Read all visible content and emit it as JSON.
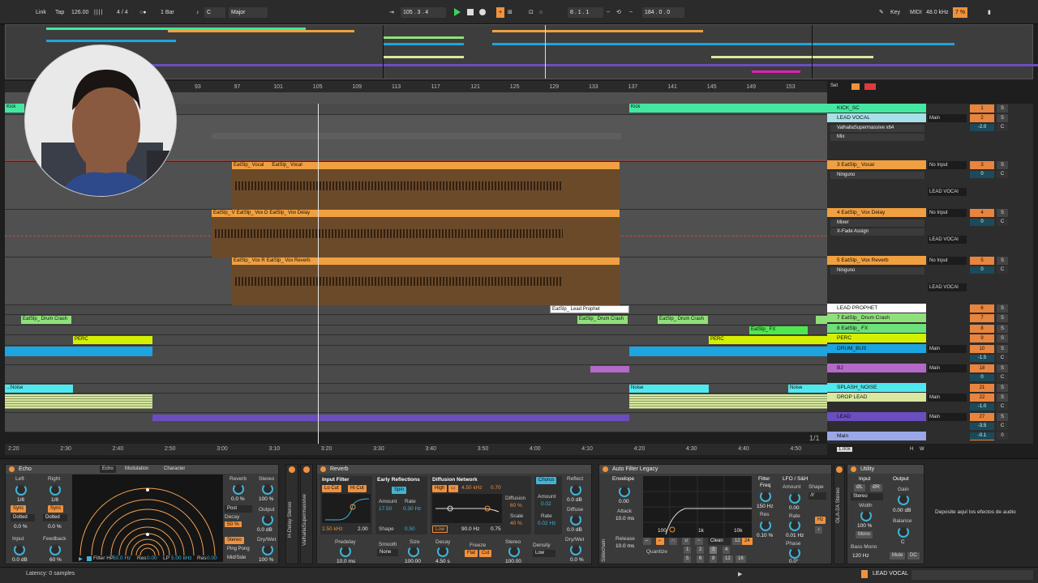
{
  "transport": {
    "link": "Link",
    "tap": "Tap",
    "tempo": "126.00",
    "signature": "4 / 4",
    "quant": "1 Bar",
    "key": "C",
    "scale": "Major",
    "position": "105 .  3 .  4",
    "loop_start": "8 .  1 .  1",
    "loop_len": "184 .  0 .  0",
    "key_btn": "Key",
    "midi": "MIDI",
    "sample_rate": "48.0 kHz",
    "cpu": "7 %"
  },
  "ruler": [
    "93",
    "97",
    "101",
    "105",
    "109",
    "113",
    "117",
    "121",
    "125",
    "129",
    "133",
    "137",
    "141",
    "145",
    "149",
    "153"
  ],
  "ruler_set": "Set",
  "time_ruler": [
    "2:20",
    "2:30",
    "2:40",
    "2:50",
    "3:00",
    "3:10",
    "3:20",
    "3:30",
    "3:40",
    "3:50",
    "4:00",
    "4:10",
    "4:20",
    "4:30",
    "4:40",
    "4:50"
  ],
  "page_indicator": "1/1",
  "zoom": "1.00x",
  "h_w": [
    "H",
    "W"
  ],
  "clips": {
    "kick_left": "Kick",
    "kick_right": "Kick",
    "vocal": "EatSlp_ Vocal",
    "vocal2": "EatSlp_ Vocal",
    "vox_delay_a": "EatSlp_ V",
    "vox_delay_b": "EatSlp_ Vox D",
    "vox_delay_c": "EatSlp_ Vox Delay",
    "vox_rev_a": "EatSlp_ Vox R",
    "vox_rev_b": "EatSlp_ Vox Reverb",
    "lead_prophet": "EatSlp_ Lead Prophet",
    "drum_crash_a": "EatSlp_ Drum Crash",
    "drum_crash_b": "EatSlp_ Drum Crash",
    "drum_crash_c": "EatSlp_ Drum Crash",
    "fx": "EatSlp_ FX",
    "perc_a": "PERC",
    "perc_b": "PERC",
    "noise_a": "...Noise",
    "noise_b": "Noise",
    "noise_c": "Noise"
  },
  "tracks": [
    {
      "name": "KICK_SC",
      "num": "1",
      "solo": "S",
      "color": "#43e8a0"
    },
    {
      "name": "LEAD VOCAL",
      "num": "2",
      "solo": "S",
      "color": "#a8dfe8",
      "io": "Main",
      "vol": "-2.0",
      "c": "C",
      "devices": [
        "ValhallaSupermassive x64",
        "Mix"
      ]
    },
    {
      "name": "3 EatSlp_ Vocal",
      "num": "3",
      "solo": "S",
      "color": "#f0a040",
      "io": "No Input",
      "vol": "0",
      "c": "C",
      "devices": [
        "Ninguno"
      ],
      "io2": "LEAD VOCAl"
    },
    {
      "name": "4 EatSlp_ Vox Delay",
      "num": "4",
      "solo": "S",
      "color": "#f0a040",
      "io": "No Input",
      "vol": "0",
      "c": "C",
      "devices": [
        "Mixer",
        "X-Fade Assign"
      ],
      "io2": "LEAD VOCAl"
    },
    {
      "name": "5 EatSlp_ Vox Reverb",
      "num": "5",
      "solo": "S",
      "color": "#f0a040",
      "io": "No Input",
      "vol": "0",
      "c": "C",
      "devices": [
        "Ninguno"
      ],
      "io2": "LEAD VOCAl"
    },
    {
      "name": "LEAD PROPHET",
      "num": "6",
      "solo": "S",
      "color": "#ffffff"
    },
    {
      "name": "7 EatSlp_ Drum Crash",
      "num": "7",
      "solo": "S",
      "color": "#8fe07a"
    },
    {
      "name": "8 EatSlp_ FX",
      "num": "8",
      "solo": "S",
      "color": "#6ee07a"
    },
    {
      "name": "PERC",
      "num": "9",
      "solo": "S",
      "color": "#d4f000"
    },
    {
      "name": "DRUM_BUS",
      "num": "10",
      "solo": "S",
      "color": "#1ca5e0",
      "io": "Main",
      "vol": "-1.5",
      "c": "C"
    },
    {
      "name": "BJ",
      "num": "18",
      "solo": "S",
      "color": "#b469c8",
      "io": "Main",
      "vol": "0",
      "c": "C"
    },
    {
      "name": "SPLASH_NOISE",
      "num": "21",
      "solo": "S",
      "color": "#4ee8ef"
    },
    {
      "name": "DROP LEAD",
      "num": "22",
      "solo": "S",
      "color": "#d8e8a0",
      "io": "Main",
      "vol": "-1.0",
      "c": "C"
    },
    {
      "name": "LEAD",
      "num": "27",
      "solo": "S",
      "color": "#6a4ec0",
      "io": "Main",
      "vol": "-3.5",
      "c": "C"
    },
    {
      "name": "Main",
      "num": "1/2",
      "solo": "",
      "color": "#9aa8e8",
      "vol": "-0.1",
      "c": "0"
    }
  ],
  "echo": {
    "title": "Echo",
    "tabs": [
      "Echo",
      "Modulation",
      "Character"
    ],
    "left": "Left",
    "right": "Right",
    "left_val": "1/8",
    "right_val": "1/8",
    "sync": "Sync",
    "dotted": "Dotted",
    "offset_l": "0.0 %",
    "offset_r": "0.0 %",
    "input": "Input",
    "input_val": "0.0 dB",
    "feedback": "Feedback",
    "feedback_val": "60 %",
    "reverb": "Reverb",
    "reverb_val": "0.0 %",
    "stereo": "Stereo",
    "stereo_val": "100 %",
    "post": "Post",
    "decay": "Decay",
    "decay_val": "50 %",
    "output": "Output",
    "output_val": "0.0 dB",
    "stereo_mode": "Stereo",
    "pingpong": "Ping Pong",
    "midside": "Mid/Side",
    "drywet": "Dry/Wet",
    "drywet_val": "100 %",
    "filter_hp": "Filter HP",
    "filter_hp_val": "50.0 Hz",
    "res": "Res",
    "res_val": "0.00",
    "lp": "LP",
    "lp_val": "5.00 kHz",
    "res2": "Res",
    "res2_val": "0.00",
    "side1": "H-Delay Stereo",
    "side2": "ValhallaSupermassive"
  },
  "reverb": {
    "title": "Reverb",
    "input_filter": "Input Filter",
    "lo_cut": "Lo Cut",
    "hi_cut": "Hi Cut",
    "freq": "2.50 kHz",
    "width": "2.00",
    "early": "Early Reflections",
    "spin": "Spin",
    "amount": "Amount",
    "amount_val": "17.50",
    "rate": "Rate",
    "rate_val": "0.30 Hz",
    "shape": "Shape",
    "shape_val": "0.50",
    "diffusion": "Diffusion Network",
    "high": "High",
    "high_freq": "4.50 kHz",
    "high_val": "0.70",
    "low": "Low",
    "low_freq": "90.0 Hz",
    "low_val": "0.75",
    "diff": "Diffusion",
    "diff_val": "60 %",
    "scale": "Scale",
    "scale_val": "40 %",
    "chorus": "Chorus",
    "ch_amount": "Amount",
    "ch_amount_val": "0.02",
    "ch_rate": "Rate",
    "ch_rate_val": "0.02 Hz",
    "reflect": "Reflect",
    "reflect_val": "0.0 dB",
    "diffuse": "Diffuse",
    "diffuse_val": "0.0 dB",
    "drywet": "Dry/Wet",
    "drywet_val": "0.0 %",
    "predelay": "Predelay",
    "predelay_val": "10.0 ms",
    "smooth": "Smooth",
    "smooth_val": "None",
    "size": "Size",
    "size_val": "100.00",
    "decay": "Decay",
    "decay_val": "4.50 s",
    "freeze": "Freeze",
    "flat": "Flat",
    "cut": "Cut",
    "stereo": "Stereo",
    "stereo_val": "100.00",
    "density": "Density",
    "density_val": "Low"
  },
  "autofilter": {
    "title": "Auto Filter Legacy",
    "envelope": "Envelope",
    "env_val": "0.00",
    "attack": "Attack",
    "attack_val": "10.0 ms",
    "release": "Release",
    "release_val": "10.0 ms",
    "freq_ticks": [
      "100",
      "1k",
      "10k"
    ],
    "clean": "Clean",
    "n12": "12",
    "n24": "24",
    "quantize": "Quantize",
    "qvals": [
      "1",
      "2",
      "3",
      "4",
      "5",
      "6",
      "8",
      "12",
      "16"
    ],
    "filter_freq": "Filter",
    "filter_freq2": "Freq",
    "freq_val": "150 Hz",
    "res": "Res",
    "res_val": "0.10 %",
    "lfo": "LFO / S&H",
    "lfo_amount": "Amount",
    "lfo_amount_val": "0.00",
    "shape": "Shape",
    "rate": "Rate",
    "rate_val": "0.01 Hz",
    "phase": "Phase",
    "phase_val": "0.0°",
    "sidechain": "Sidechain"
  },
  "utility": {
    "title": "Utility",
    "input": "Input",
    "output": "Output",
    "phi_l": "ØL",
    "phi_r": "ØR",
    "stereo": "Stereo",
    "gain": "Gain",
    "gain_val": "0.00 dB",
    "width": "Width",
    "width_val": "100 %",
    "mono": "Mono",
    "balance": "Balance",
    "balance_val": "C",
    "bass_mono": "Bass Mono",
    "bass_freq": "120 Hz",
    "mute": "Mute",
    "dc": "DC",
    "side": "GLA-2A Stereo"
  },
  "drop_hint": "Deposite aquí los efectos de audio",
  "status": {
    "latency": "Latency: 0 samples",
    "track": "LEAD VOCAL"
  }
}
